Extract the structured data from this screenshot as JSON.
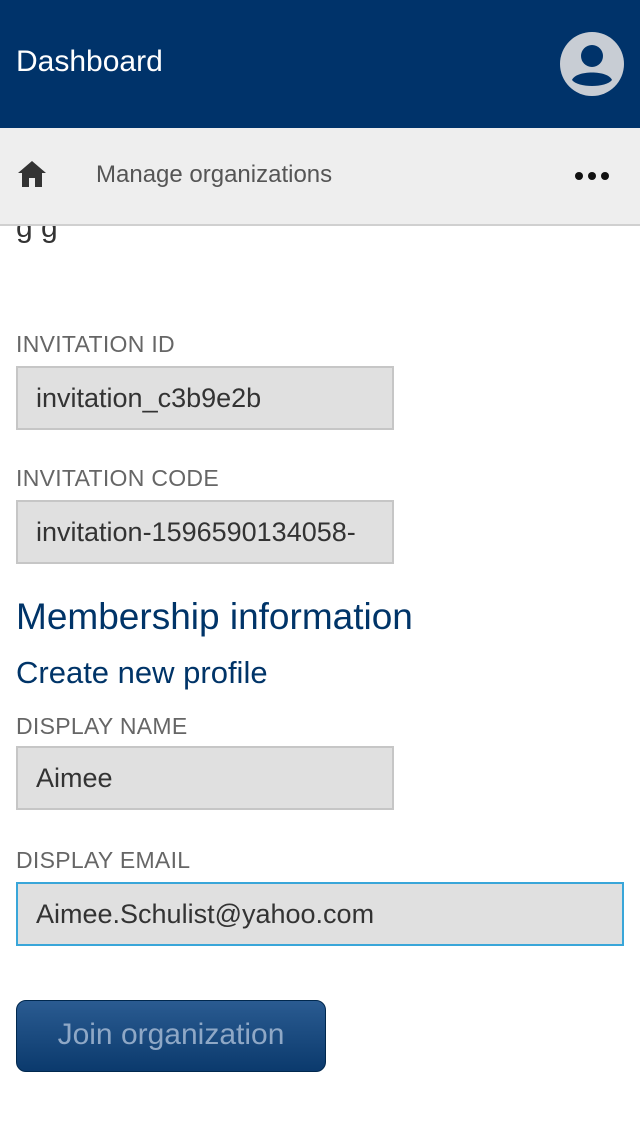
{
  "header": {
    "title": "Dashboard",
    "avatar_icon": "account-circle-icon"
  },
  "toolbar": {
    "home_icon": "home-icon",
    "title": "Manage organizations",
    "more_icon": "more-horizontal-icon"
  },
  "form": {
    "clipped_text": "g g",
    "invitation_id": {
      "label": "INVITATION ID",
      "value": "invitation_c3b9e2b"
    },
    "invitation_code": {
      "label": "INVITATION CODE",
      "value": "invitation-1596590134058-"
    },
    "membership": {
      "heading": "Membership information",
      "subheading": "Create new profile"
    },
    "display_name": {
      "label": "DISPLAY NAME",
      "value": "Aimee"
    },
    "display_email": {
      "label": "DISPLAY EMAIL",
      "value": "Aimee.Schulist@yahoo.com"
    },
    "join_button": "Join organization"
  },
  "colors": {
    "header_bg": "#00336a",
    "heading_text": "#003468",
    "focus_border": "#39a6d9"
  }
}
